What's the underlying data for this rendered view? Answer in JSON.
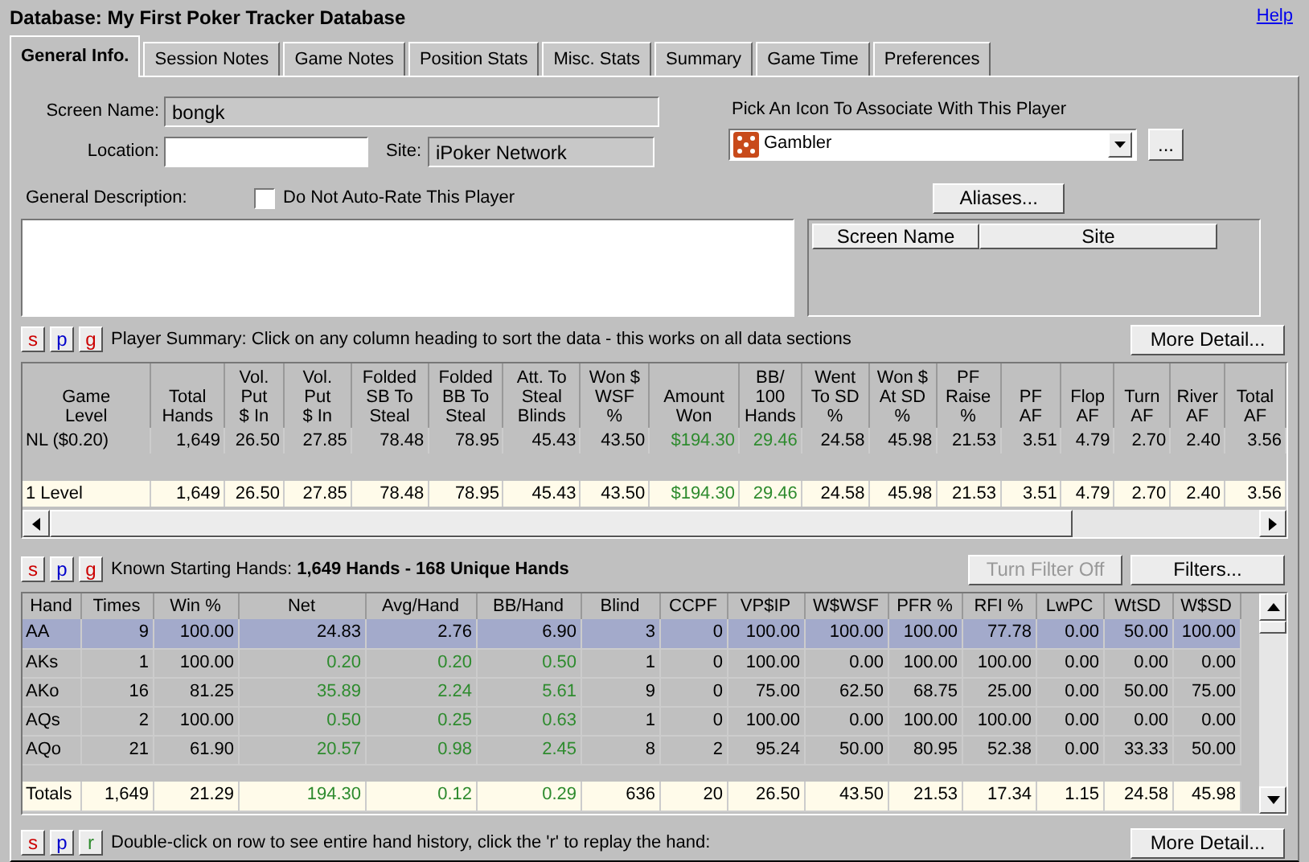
{
  "window": {
    "title": "Database: My First Poker Tracker Database",
    "help_link": "Help"
  },
  "tabs": [
    {
      "label": "General Info.",
      "selected": true
    },
    {
      "label": "Session Notes",
      "selected": false
    },
    {
      "label": "Game Notes",
      "selected": false
    },
    {
      "label": "Position Stats",
      "selected": false
    },
    {
      "label": "Misc. Stats",
      "selected": false
    },
    {
      "label": "Summary",
      "selected": false
    },
    {
      "label": "Game Time",
      "selected": false
    },
    {
      "label": "Preferences",
      "selected": false
    }
  ],
  "form": {
    "screen_name": {
      "label": "Screen Name:",
      "value": "bongk"
    },
    "location": {
      "label": "Location:"
    },
    "site": {
      "label": "Site:",
      "value": "iPoker Network"
    },
    "icon_picker": {
      "label": "Pick An Icon To Associate With This Player",
      "value": "Gambler"
    },
    "browse_button": "...",
    "general_description_label": "General Description:",
    "no_auto_rate": {
      "label": "Do Not Auto-Rate This Player",
      "checked": false
    },
    "aliases_button": "Aliases...",
    "aliases_columns": [
      "Screen Name",
      "Site"
    ]
  },
  "player_summary": {
    "mini_buttons": [
      {
        "label": "s",
        "color": "#cc0000"
      },
      {
        "label": "p",
        "color": "#0000cc"
      },
      {
        "label": "g",
        "color": "#cc0000"
      }
    ],
    "caption": "Player Summary: Click on any column heading to sort the data - this works on all data sections",
    "more_detail_button": "More Detail...",
    "columns": [
      "Game\nLevel",
      "Total\nHands",
      "Vol.\nPut\n$ In",
      "Vol.\nPut\n$ In",
      "Folded\nSB To\nSteal",
      "Folded\nBB To\nSteal",
      "Att. To\nSteal\nBlinds",
      "Won $\nWSF\n%",
      "Amount\nWon",
      "BB/\n100\nHands",
      "Went\nTo SD\n%",
      "Won $\nAt SD\n%",
      "PF\nRaise\n%",
      "PF\nAF",
      "Flop\nAF",
      "Turn\nAF",
      "River\nAF",
      "Total\nAF"
    ],
    "rows": [
      {
        "kind": "data",
        "cells": [
          "NL ($0.20)",
          "1,649",
          "26.50",
          "27.85",
          "78.48",
          "78.95",
          "45.43",
          "43.50",
          {
            "text": "$194.30",
            "color": "#2e8b2e"
          },
          {
            "text": "29.46",
            "color": "#2e8b2e"
          },
          "24.58",
          "45.98",
          "21.53",
          "3.51",
          "4.79",
          "2.70",
          "2.40",
          "3.56"
        ]
      },
      {
        "kind": "total",
        "cells": [
          "1 Level",
          "1,649",
          "26.50",
          "27.85",
          "78.48",
          "78.95",
          "45.43",
          "43.50",
          {
            "text": "$194.30",
            "color": "#2e8b2e"
          },
          {
            "text": "29.46",
            "color": "#2e8b2e"
          },
          "24.58",
          "45.98",
          "21.53",
          "3.51",
          "4.79",
          "2.70",
          "2.40",
          "3.56"
        ]
      }
    ]
  },
  "starting_hands": {
    "mini_buttons": [
      {
        "label": "s",
        "color": "#cc0000"
      },
      {
        "label": "p",
        "color": "#0000cc"
      },
      {
        "label": "g",
        "color": "#cc0000"
      }
    ],
    "caption": "Known Starting Hands: **1,649 Hands - 168 Unique Hands**",
    "turn_filter_off_button": {
      "label": "Turn Filter Off",
      "disabled": true
    },
    "filters_button": "Filters...",
    "columns": [
      "Hand",
      "Times",
      "Win %",
      "Net",
      "Avg/Hand",
      "BB/Hand",
      "Blind",
      "CCPF",
      "VP$IP",
      "W$WSF",
      "PFR %",
      "RFI %",
      "LwPC",
      "WtSD",
      "W$SD"
    ],
    "rows": [
      {
        "kind": "data",
        "selected": true,
        "cells": [
          "AA",
          "9",
          "100.00",
          "24.83",
          "2.76",
          "6.90",
          "3",
          "0",
          "100.00",
          "100.00",
          "100.00",
          "77.78",
          "0.00",
          "50.00",
          "100.00"
        ]
      },
      {
        "kind": "data",
        "selected": false,
        "cells": [
          "AKs",
          "1",
          "100.00",
          {
            "text": "0.20",
            "color": "#2e8b2e"
          },
          {
            "text": "0.20",
            "color": "#2e8b2e"
          },
          {
            "text": "0.50",
            "color": "#2e8b2e"
          },
          "1",
          "0",
          "100.00",
          "0.00",
          "100.00",
          "100.00",
          "0.00",
          "0.00",
          "0.00"
        ]
      },
      {
        "kind": "data",
        "selected": false,
        "cells": [
          "AKo",
          "16",
          "81.25",
          {
            "text": "35.89",
            "color": "#2e8b2e"
          },
          {
            "text": "2.24",
            "color": "#2e8b2e"
          },
          {
            "text": "5.61",
            "color": "#2e8b2e"
          },
          "9",
          "0",
          "75.00",
          "62.50",
          "68.75",
          "25.00",
          "0.00",
          "50.00",
          "75.00"
        ]
      },
      {
        "kind": "data",
        "selected": false,
        "cells": [
          "AQs",
          "2",
          "100.00",
          {
            "text": "0.50",
            "color": "#2e8b2e"
          },
          {
            "text": "0.25",
            "color": "#2e8b2e"
          },
          {
            "text": "0.63",
            "color": "#2e8b2e"
          },
          "1",
          "0",
          "100.00",
          "0.00",
          "100.00",
          "100.00",
          "0.00",
          "0.00",
          "0.00"
        ]
      },
      {
        "kind": "data",
        "selected": false,
        "cells": [
          "AQo",
          "21",
          "61.90",
          {
            "text": "20.57",
            "color": "#2e8b2e"
          },
          {
            "text": "0.98",
            "color": "#2e8b2e"
          },
          {
            "text": "2.45",
            "color": "#2e8b2e"
          },
          "8",
          "2",
          "95.24",
          "50.00",
          "80.95",
          "52.38",
          "0.00",
          "33.33",
          "50.00"
        ]
      },
      {
        "kind": "total",
        "selected": false,
        "cells": [
          "Totals",
          "1,649",
          "21.29",
          {
            "text": "194.30",
            "color": "#2e8b2e"
          },
          {
            "text": "0.12",
            "color": "#2e8b2e"
          },
          {
            "text": "0.29",
            "color": "#2e8b2e"
          },
          "636",
          "20",
          "26.50",
          "43.50",
          "21.53",
          "17.34",
          "1.15",
          "24.58",
          "45.98"
        ]
      }
    ]
  },
  "hand_history": {
    "mini_buttons": [
      {
        "label": "s",
        "color": "#cc0000"
      },
      {
        "label": "p",
        "color": "#0000cc"
      },
      {
        "label": "r",
        "color": "#2e8b2e"
      }
    ],
    "caption": "Double-click on row to see entire hand history, click the 'r' to replay the hand:",
    "more_detail_button": "More Detail..."
  }
}
